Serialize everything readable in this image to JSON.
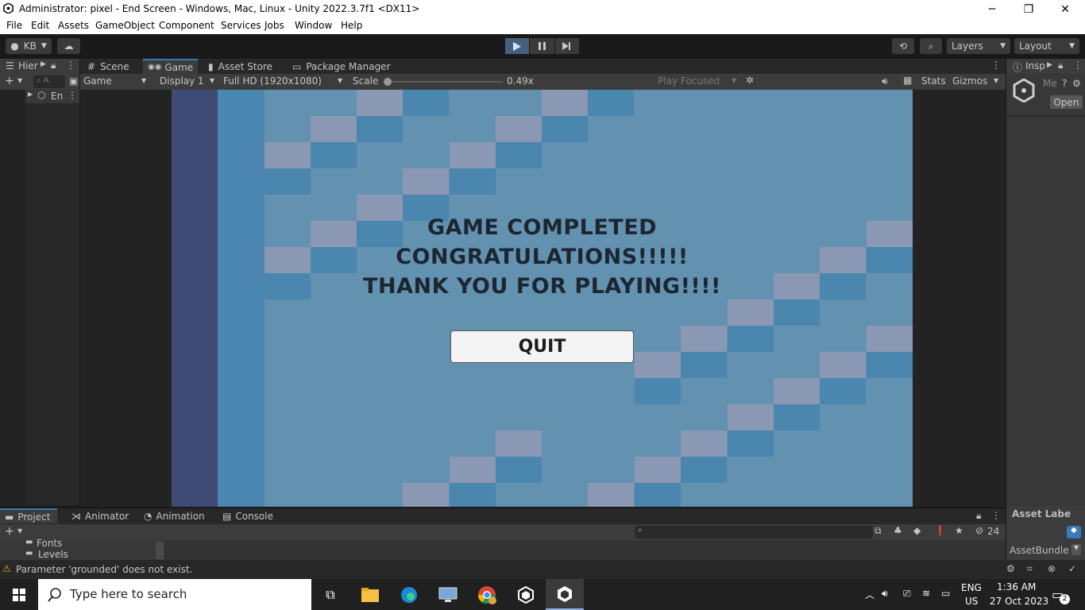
{
  "window": {
    "title": "Administrator: pixel - End Screen - Windows, Mac, Linux - Unity 2022.3.7f1 <DX11>",
    "minimize": "─",
    "restore": "❐",
    "close": "✕"
  },
  "menu": [
    "File",
    "Edit",
    "Assets",
    "GameObject",
    "Component",
    "Services",
    "Jobs",
    "Window",
    "Help"
  ],
  "toolbar": {
    "account": "KB",
    "layers": "Layers",
    "layout": "Layout"
  },
  "hierarchy": {
    "tab": "Hier",
    "search_placeholder": "A",
    "scene_item": "En"
  },
  "center_tabs": [
    "Scene",
    "Game",
    "Asset Store",
    "Package Manager"
  ],
  "game_toolbar": {
    "mode": "Game",
    "display": "Display 1",
    "resolution": "Full HD (1920x1080)",
    "scale_label": "Scale",
    "scale_value": "0.49x",
    "play_focused": "Play Focused",
    "stats": "Stats",
    "gizmos": "Gizmos"
  },
  "scale_level": 0.02,
  "game": {
    "line1": "GAME COMPLETED",
    "line2": "CONGRATULATIONS!!!!!",
    "line3": "THANK YOU FOR PLAYING!!!!",
    "quit_label": "QUIT"
  },
  "inspector": {
    "tab": "Insp",
    "item": "Me",
    "open_button": "Open",
    "asset_labels": "Asset Labe",
    "asset_bundle": "AssetBundle"
  },
  "bottom_tabs": [
    "Project",
    "Animator",
    "Animation",
    "Console"
  ],
  "project": {
    "folders": [
      "Fonts",
      "Levels"
    ],
    "hidden_count": "24"
  },
  "status": {
    "message": "Parameter 'grounded' does not exist."
  },
  "taskbar": {
    "search_placeholder": "Type here to search",
    "lang1": "ENG",
    "lang2": "US",
    "time": "1:36 AM",
    "date": "27 Oct 2023",
    "notif_count": "2"
  },
  "colors": {
    "game_bg": "#6391b0",
    "tile_light": "#8b98b4",
    "tile_dark": "#4a86ae",
    "play_active": "#46607c"
  }
}
